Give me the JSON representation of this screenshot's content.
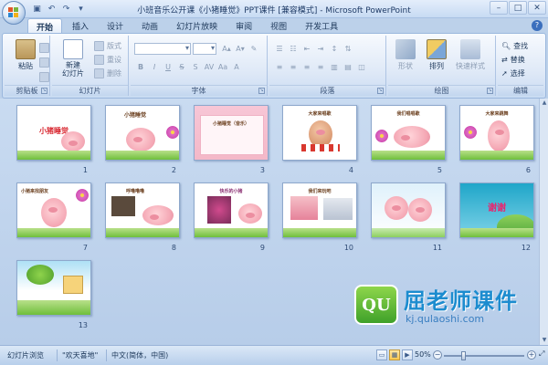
{
  "app": {
    "title": "小班音乐公开课《小猪睡觉》PPT课件 [兼容模式] - Microsoft PowerPoint"
  },
  "qat": {
    "icons": [
      "save-icon",
      "undo-icon",
      "redo-icon",
      "customize-icon"
    ]
  },
  "tabs": [
    {
      "label": "开始",
      "active": true
    },
    {
      "label": "插入",
      "active": false
    },
    {
      "label": "设计",
      "active": false
    },
    {
      "label": "动画",
      "active": false
    },
    {
      "label": "幻灯片放映",
      "active": false
    },
    {
      "label": "审阅",
      "active": false
    },
    {
      "label": "视图",
      "active": false
    },
    {
      "label": "开发工具",
      "active": false
    }
  ],
  "ribbon": {
    "clipboard": {
      "label": "剪贴板",
      "paste": "粘贴"
    },
    "slides": {
      "label": "幻灯片",
      "new_slide": "新建\n幻灯片",
      "layout": "版式",
      "reset": "重设",
      "delete": "删除"
    },
    "font": {
      "label": "字体"
    },
    "paragraph": {
      "label": "段落"
    },
    "drawing": {
      "label": "绘图",
      "shapes": "形状",
      "arrange": "排列",
      "quick_styles": "快速样式"
    },
    "editing": {
      "label": "编辑",
      "find": "查找",
      "replace": "替换",
      "select": "选择"
    }
  },
  "slides": [
    {
      "num": "1",
      "title": "小猪睡觉"
    },
    {
      "num": "2",
      "title": "小猪睡觉"
    },
    {
      "num": "3",
      "title": "小猪睡觉（音乐）"
    },
    {
      "num": "4",
      "title": "大家来唱歌"
    },
    {
      "num": "5",
      "title": "我们唱唱歌"
    },
    {
      "num": "6",
      "title": "大家来跳舞"
    },
    {
      "num": "7",
      "title": "小猪来找朋友"
    },
    {
      "num": "8",
      "title": "呼噜噜噜"
    },
    {
      "num": "9",
      "title": "快乐的小猪"
    },
    {
      "num": "10",
      "title": "我们来玩吧"
    },
    {
      "num": "11",
      "title": ""
    },
    {
      "num": "12",
      "title": "谢谢"
    },
    {
      "num": "13",
      "title": ""
    }
  ],
  "watermark": {
    "logo": "QU",
    "name": "屈老师课件",
    "url": "kj.qulaoshi.com"
  },
  "status": {
    "view": "幻灯片浏览",
    "theme": "\"欢天喜地\"",
    "language": "中文(简体，中国)",
    "zoom": "50%",
    "zoom_level": 0.5
  },
  "colors": {
    "accent": "#1c8ccf",
    "ribbon_bg": "#dfe9f7",
    "workspace": "#bcd1ea"
  }
}
